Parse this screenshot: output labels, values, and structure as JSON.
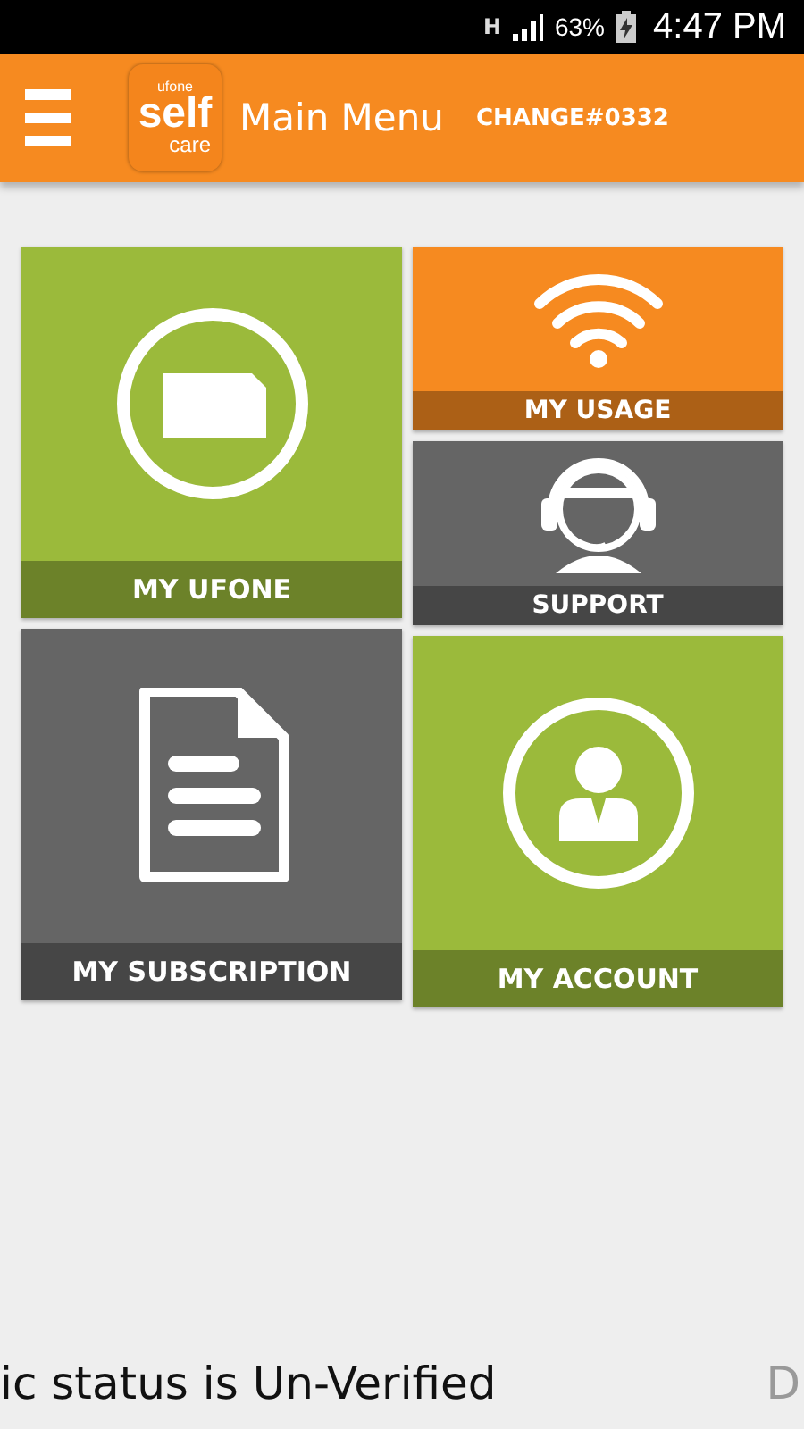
{
  "status_bar": {
    "network": "H",
    "battery": "63%",
    "time": "4:47 PM"
  },
  "header": {
    "logo": {
      "brand": "ufone",
      "top": "self",
      "bottom": "care"
    },
    "title": "Main Menu",
    "number": "CHANGE#0332"
  },
  "tiles": [
    {
      "label": "MY UFONE",
      "kind": "sim",
      "color": "#9bba3b"
    },
    {
      "label": "MY SUBSCRIPTION",
      "kind": "document",
      "color": "#656565"
    },
    {
      "label": "MY USAGE",
      "kind": "wifi",
      "color": "#f68a20"
    },
    {
      "label": "SUPPORT",
      "kind": "support",
      "color": "#656565"
    },
    {
      "label": "MY ACCOUNT",
      "kind": "account",
      "color": "#9bba3b"
    }
  ],
  "ticker": {
    "text": "ic status is Un-Verified",
    "next": "D"
  }
}
